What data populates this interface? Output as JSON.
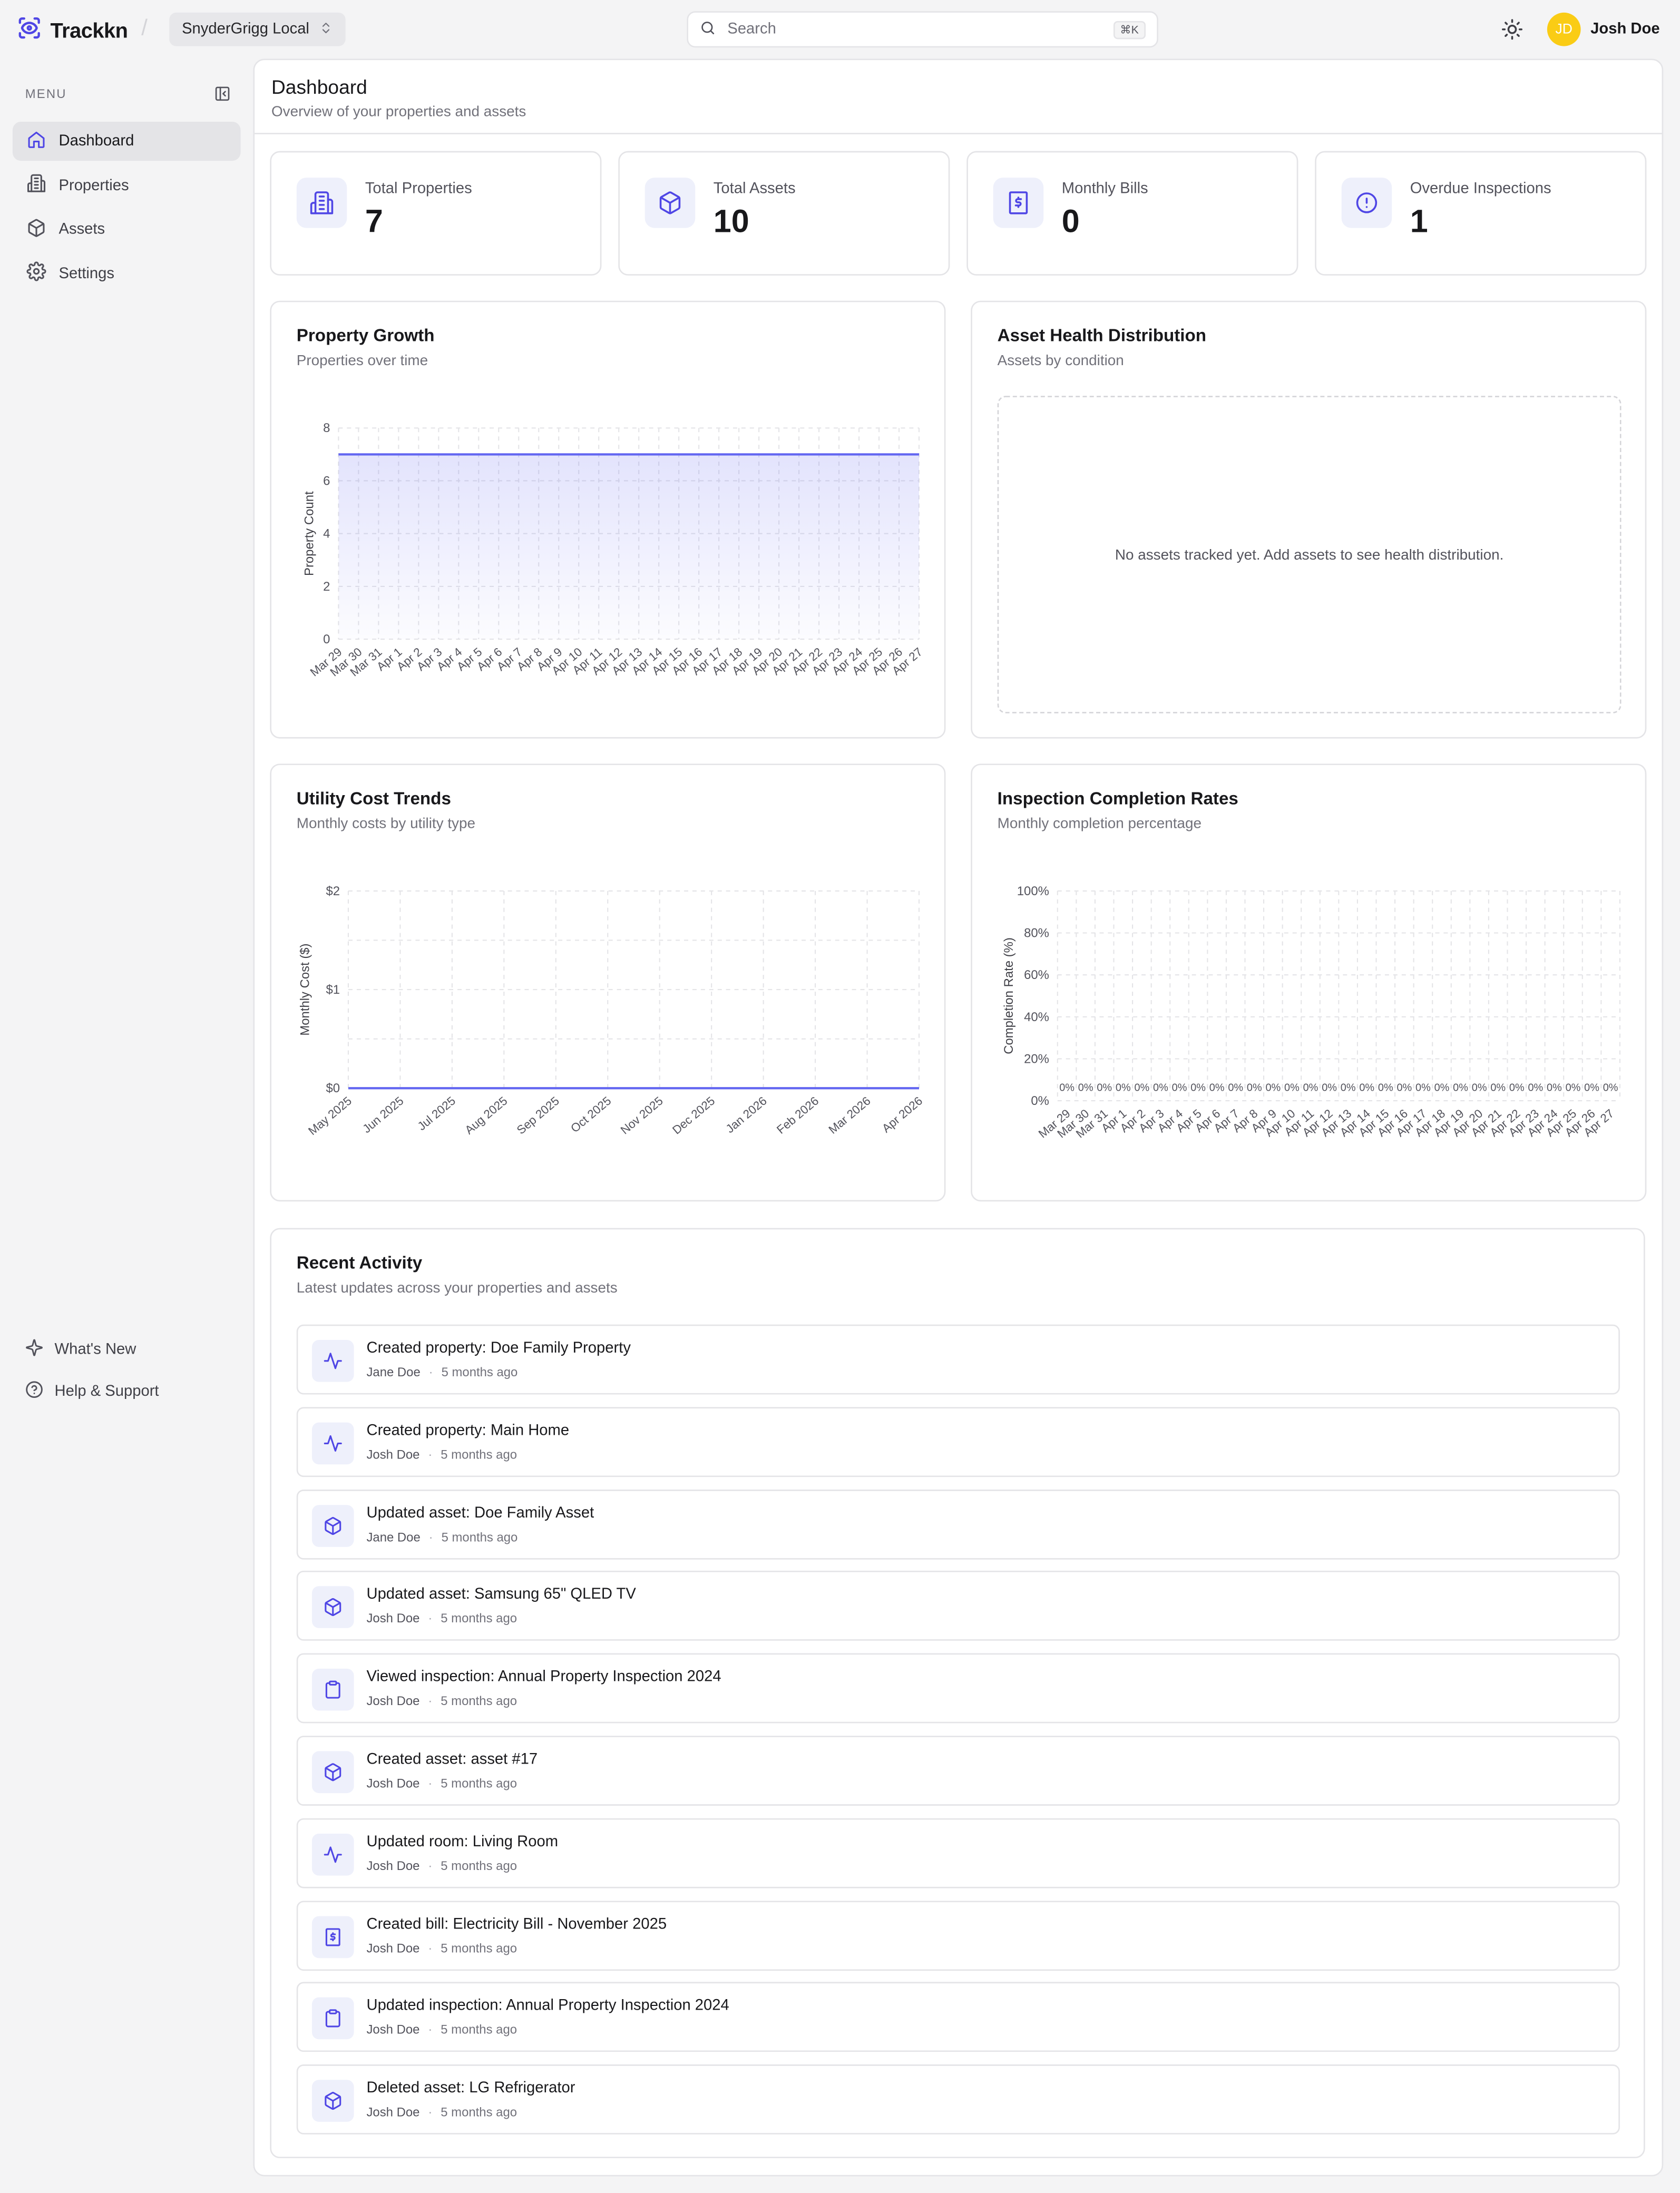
{
  "app": {
    "name": "Trackkn",
    "workspace": "SnyderGrigg Local"
  },
  "search": {
    "placeholder": "Search",
    "shortcut": "⌘K"
  },
  "user": {
    "initials": "JD",
    "name": "Josh Doe"
  },
  "sidebar": {
    "menu_label": "MENU",
    "items": [
      {
        "label": "Dashboard",
        "icon": "home-icon",
        "active": true
      },
      {
        "label": "Properties",
        "icon": "building-icon",
        "active": false
      },
      {
        "label": "Assets",
        "icon": "box-icon",
        "active": false
      },
      {
        "label": "Settings",
        "icon": "gear-icon",
        "active": false
      }
    ],
    "footer": [
      {
        "label": "What's New",
        "icon": "sparkles-icon"
      },
      {
        "label": "Help & Support",
        "icon": "help-circle-icon"
      }
    ]
  },
  "page": {
    "title": "Dashboard",
    "subtitle": "Overview of your properties and assets"
  },
  "stats": [
    {
      "label": "Total Properties",
      "value": "7",
      "icon": "building-icon"
    },
    {
      "label": "Total Assets",
      "value": "10",
      "icon": "box-icon"
    },
    {
      "label": "Monthly Bills",
      "value": "0",
      "icon": "receipt-icon"
    },
    {
      "label": "Overdue Inspections",
      "value": "1",
      "icon": "alert-circle-icon"
    }
  ],
  "colors": {
    "accent": "#6366f1",
    "accent_bg": "#eef0fb",
    "avatar": "#facc15"
  },
  "cards": {
    "growth": {
      "title": "Property Growth",
      "subtitle": "Properties over time"
    },
    "health": {
      "title": "Asset Health Distribution",
      "subtitle": "Assets by condition",
      "empty": "No assets tracked yet. Add assets to see health distribution."
    },
    "utility": {
      "title": "Utility Cost Trends",
      "subtitle": "Monthly costs by utility type"
    },
    "inspection": {
      "title": "Inspection Completion Rates",
      "subtitle": "Monthly completion percentage"
    }
  },
  "chart_data": [
    {
      "type": "area",
      "ylabel": "Property Count",
      "ylim": [
        0,
        8
      ],
      "yticks": [
        0,
        2,
        4,
        6,
        8
      ],
      "categories": [
        "Mar 29",
        "Mar 30",
        "Mar 31",
        "Apr 1",
        "Apr 2",
        "Apr 3",
        "Apr 4",
        "Apr 5",
        "Apr 6",
        "Apr 7",
        "Apr 8",
        "Apr 9",
        "Apr 10",
        "Apr 11",
        "Apr 12",
        "Apr 13",
        "Apr 14",
        "Apr 15",
        "Apr 16",
        "Apr 17",
        "Apr 18",
        "Apr 19",
        "Apr 20",
        "Apr 21",
        "Apr 22",
        "Apr 23",
        "Apr 24",
        "Apr 25",
        "Apr 26",
        "Apr 27"
      ],
      "values": [
        7,
        7,
        7,
        7,
        7,
        7,
        7,
        7,
        7,
        7,
        7,
        7,
        7,
        7,
        7,
        7,
        7,
        7,
        7,
        7,
        7,
        7,
        7,
        7,
        7,
        7,
        7,
        7,
        7,
        7
      ],
      "grid": true
    },
    {
      "type": "line",
      "ylabel": "Monthly Cost ($)",
      "ylim": [
        0,
        2
      ],
      "yticks": [
        "$0",
        "$1",
        "$2"
      ],
      "categories": [
        "May 2025",
        "Jun 2025",
        "Jul 2025",
        "Aug 2025",
        "Sep 2025",
        "Oct 2025",
        "Nov 2025",
        "Dec 2025",
        "Jan 2026",
        "Feb 2026",
        "Mar 2026",
        "Apr 2026"
      ],
      "values": [
        0,
        0,
        0,
        0,
        0,
        0,
        0,
        0,
        0,
        0,
        0,
        0
      ],
      "grid": true
    },
    {
      "type": "bar",
      "ylabel": "Completion Rate (%)",
      "ylim": [
        0,
        100
      ],
      "yticks": [
        "0%",
        "20%",
        "40%",
        "60%",
        "80%",
        "100%"
      ],
      "categories": [
        "Mar 29",
        "Mar 30",
        "Mar 31",
        "Apr 1",
        "Apr 2",
        "Apr 3",
        "Apr 4",
        "Apr 5",
        "Apr 6",
        "Apr 7",
        "Apr 8",
        "Apr 9",
        "Apr 10",
        "Apr 11",
        "Apr 12",
        "Apr 13",
        "Apr 14",
        "Apr 15",
        "Apr 16",
        "Apr 17",
        "Apr 18",
        "Apr 19",
        "Apr 20",
        "Apr 21",
        "Apr 22",
        "Apr 23",
        "Apr 24",
        "Apr 25",
        "Apr 26",
        "Apr 27"
      ],
      "values": [
        0,
        0,
        0,
        0,
        0,
        0,
        0,
        0,
        0,
        0,
        0,
        0,
        0,
        0,
        0,
        0,
        0,
        0,
        0,
        0,
        0,
        0,
        0,
        0,
        0,
        0,
        0,
        0,
        0,
        0
      ],
      "data_labels": "0%",
      "grid": true
    }
  ],
  "activity": {
    "title": "Recent Activity",
    "subtitle": "Latest updates across your properties and assets",
    "items": [
      {
        "text": "Created property: Doe Family Property",
        "user": "Jane Doe",
        "time": "5 months ago",
        "icon": "activity-icon"
      },
      {
        "text": "Created property: Main Home",
        "user": "Josh Doe",
        "time": "5 months ago",
        "icon": "activity-icon"
      },
      {
        "text": "Updated asset: Doe Family Asset",
        "user": "Jane Doe",
        "time": "5 months ago",
        "icon": "box-icon"
      },
      {
        "text": "Updated asset: Samsung 65\" QLED TV",
        "user": "Josh Doe",
        "time": "5 months ago",
        "icon": "box-icon"
      },
      {
        "text": "Viewed inspection: Annual Property Inspection 2024",
        "user": "Josh Doe",
        "time": "5 months ago",
        "icon": "clipboard-icon"
      },
      {
        "text": "Created asset: asset #17",
        "user": "Josh Doe",
        "time": "5 months ago",
        "icon": "box-icon"
      },
      {
        "text": "Updated room: Living Room",
        "user": "Josh Doe",
        "time": "5 months ago",
        "icon": "activity-icon"
      },
      {
        "text": "Created bill: Electricity Bill - November 2025",
        "user": "Josh Doe",
        "time": "5 months ago",
        "icon": "receipt-icon"
      },
      {
        "text": "Updated inspection: Annual Property Inspection 2024",
        "user": "Josh Doe",
        "time": "5 months ago",
        "icon": "clipboard-icon"
      },
      {
        "text": "Deleted asset: LG Refrigerator",
        "user": "Josh Doe",
        "time": "5 months ago",
        "icon": "box-icon"
      }
    ]
  }
}
